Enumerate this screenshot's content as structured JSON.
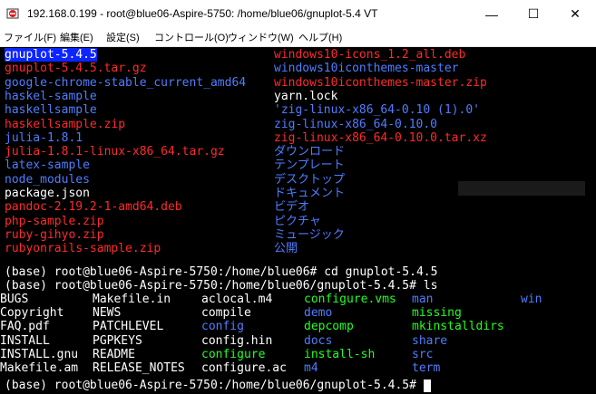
{
  "title": "192.168.0.199 - root@blue06-Aspire-5750: /home/blue06/gnuplot-5.4 VT",
  "menu": [
    "ファイル(F)",
    "編集(E)",
    "設定(S)",
    "コントロール(O)",
    "ウィンドウ(W)",
    "ヘルプ(H)"
  ],
  "window_buttons": {
    "minimize": "—",
    "maximize": "☐",
    "close": "✕"
  },
  "listing_left": [
    {
      "text": "gnuplot-5.4.5",
      "color": "selected"
    },
    {
      "text": "gnuplot-5.4.5.tar.gz",
      "color": "red"
    },
    {
      "text": "google-chrome-stable_current_amd64",
      "color": "blue"
    },
    {
      "text": "haskel-sample",
      "color": "blue"
    },
    {
      "text": "haskellsample",
      "color": "blue"
    },
    {
      "text": "haskellsample.zip",
      "color": "red"
    },
    {
      "text": "julia-1.8.1",
      "color": "blue"
    },
    {
      "text": "julia-1.8.1-linux-x86_64.tar.gz",
      "color": "red"
    },
    {
      "text": "latex-sample",
      "color": "blue"
    },
    {
      "text": "node_modules",
      "color": "blue"
    },
    {
      "text": "package.json",
      "color": "white"
    },
    {
      "text": "pandoc-2.19.2-1-amd64.deb",
      "color": "red"
    },
    {
      "text": "php-sample.zip",
      "color": "red"
    },
    {
      "text": "ruby-gihyo.zip",
      "color": "red"
    },
    {
      "text": "rubyonrails-sample.zip",
      "color": "red"
    }
  ],
  "listing_right": [
    {
      "text": "windows10-icons_1.2_all.deb",
      "color": "red"
    },
    {
      "text": "windows10iconthemes-master",
      "color": "blue"
    },
    {
      "text": "windows10iconthemes-master.zip",
      "color": "red"
    },
    {
      "text": "yarn.lock",
      "color": "white"
    },
    {
      "text": "'zig-linux-x86_64-0.10 (1).0'",
      "color": "blue"
    },
    {
      "text": "zig-linux-x86_64-0.10.0",
      "color": "blue"
    },
    {
      "text": "zig-linux-x86_64-0.10.0.tar.xz",
      "color": "red"
    },
    {
      "text": "ダウンロード",
      "color": "blue"
    },
    {
      "text": "テンプレート",
      "color": "blue"
    },
    {
      "text": "デスクトップ",
      "color": "blue"
    },
    {
      "text": "ドキュメント",
      "color": "blue"
    },
    {
      "text": "ビデオ",
      "color": "blue"
    },
    {
      "text": "ピクチャ",
      "color": "blue"
    },
    {
      "text": "ミュージック",
      "color": "blue"
    },
    {
      "text": "公開",
      "color": "blue"
    }
  ],
  "prompts": [
    "(base) root@blue06-Aspire-5750:/home/blue06# cd gnuplot-5.4.5",
    "(base) root@blue06-Aspire-5750:/home/blue06/gnuplot-5.4.5# ls"
  ],
  "ls_rows": [
    [
      {
        "text": "BUGS",
        "color": "white"
      },
      {
        "text": "Makefile.in",
        "color": "white"
      },
      {
        "text": "aclocal.m4",
        "color": "white"
      },
      {
        "text": "configure.vms",
        "color": "green"
      },
      {
        "text": "man",
        "color": "blue"
      },
      {
        "text": "win",
        "color": "blue"
      }
    ],
    [
      {
        "text": "Copyright",
        "color": "white"
      },
      {
        "text": "NEWS",
        "color": "white"
      },
      {
        "text": "compile",
        "color": "white"
      },
      {
        "text": "demo",
        "color": "blue"
      },
      {
        "text": "missing",
        "color": "green"
      },
      {
        "text": "",
        "color": "white"
      }
    ],
    [
      {
        "text": "FAQ.pdf",
        "color": "white"
      },
      {
        "text": "PATCHLEVEL",
        "color": "white"
      },
      {
        "text": "config",
        "color": "blue"
      },
      {
        "text": "depcomp",
        "color": "green"
      },
      {
        "text": "mkinstalldirs",
        "color": "green"
      },
      {
        "text": "",
        "color": "white"
      }
    ],
    [
      {
        "text": "INSTALL",
        "color": "white"
      },
      {
        "text": "PGPKEYS",
        "color": "white"
      },
      {
        "text": "config.hin",
        "color": "white"
      },
      {
        "text": "docs",
        "color": "blue"
      },
      {
        "text": "share",
        "color": "blue"
      },
      {
        "text": "",
        "color": "white"
      }
    ],
    [
      {
        "text": "INSTALL.gnu",
        "color": "white"
      },
      {
        "text": "README",
        "color": "white"
      },
      {
        "text": "configure",
        "color": "green"
      },
      {
        "text": "install-sh",
        "color": "green"
      },
      {
        "text": "src",
        "color": "blue"
      },
      {
        "text": "",
        "color": "white"
      }
    ],
    [
      {
        "text": "Makefile.am",
        "color": "white"
      },
      {
        "text": "RELEASE_NOTES",
        "color": "white"
      },
      {
        "text": "configure.ac",
        "color": "white"
      },
      {
        "text": "m4",
        "color": "blue"
      },
      {
        "text": "term",
        "color": "blue"
      },
      {
        "text": "",
        "color": "white"
      }
    ]
  ],
  "final_prompt": "(base) root@blue06-Aspire-5750:/home/blue06/gnuplot-5.4.5# "
}
